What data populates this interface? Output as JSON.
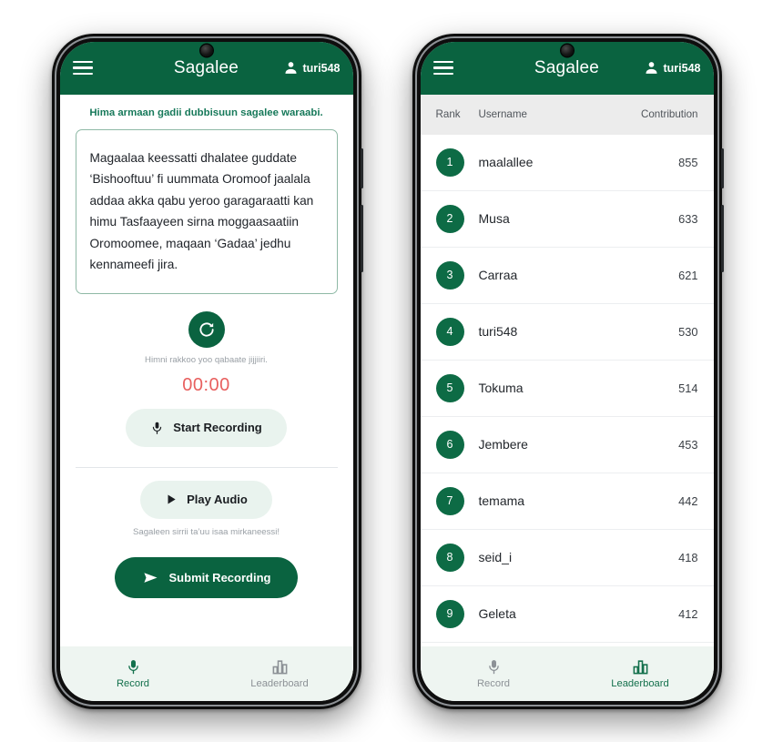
{
  "header": {
    "title": "Sagalee",
    "username": "turi548",
    "menu_icon": "hamburger-menu-icon",
    "avatar_icon": "person-icon"
  },
  "record_page": {
    "prompt": "Hima armaan gadii dubbisuun sagalee waraabi.",
    "sentence": "Magaalaa keessatti dhalatee guddate ‘Bishooftuu’ fi uummata Oromoof jaalala addaa akka qabu yeroo garagaraatti kan himu Tasfaayeen sirna moggaasaatiin Oromoomee, maqaan ‘Gadaa’ jedhu kennameefi jira.",
    "refresh_icon": "refresh-icon",
    "refresh_hint": "Himni rakkoo yoo qabaate jijjiiri.",
    "timer": "00:00",
    "start_recording_label": "Start Recording",
    "mic_icon": "microphone-icon",
    "play_audio_label": "Play Audio",
    "play_icon": "play-icon",
    "play_hint": "Sagaleen sirrii ta’uu isaa mirkaneessi!",
    "submit_label": "Submit Recording",
    "send_icon": "send-icon"
  },
  "leaderboard": {
    "columns": {
      "rank": "Rank",
      "username": "Username",
      "contribution": "Contribution"
    },
    "rows": [
      {
        "rank": "1",
        "username": "maalallee",
        "contribution": "855"
      },
      {
        "rank": "2",
        "username": "Musa",
        "contribution": "633"
      },
      {
        "rank": "3",
        "username": "Carraa",
        "contribution": "621"
      },
      {
        "rank": "4",
        "username": "turi548",
        "contribution": "530"
      },
      {
        "rank": "5",
        "username": "Tokuma",
        "contribution": "514"
      },
      {
        "rank": "6",
        "username": "Jembere",
        "contribution": "453"
      },
      {
        "rank": "7",
        "username": "temama",
        "contribution": "442"
      },
      {
        "rank": "8",
        "username": "seid_i",
        "contribution": "418"
      },
      {
        "rank": "9",
        "username": "Geleta",
        "contribution": "412"
      }
    ]
  },
  "bottom_nav": {
    "record_label": "Record",
    "leaderboard_label": "Leaderboard",
    "record_icon": "microphone-icon",
    "leaderboard_icon": "bar-chart-icon"
  },
  "colors": {
    "brand_green": "#0a6340",
    "accent_green": "#17795a",
    "timer_red": "#e8605f",
    "pill_bg": "#e9f3ee",
    "nav_bg": "#eef5f1"
  }
}
